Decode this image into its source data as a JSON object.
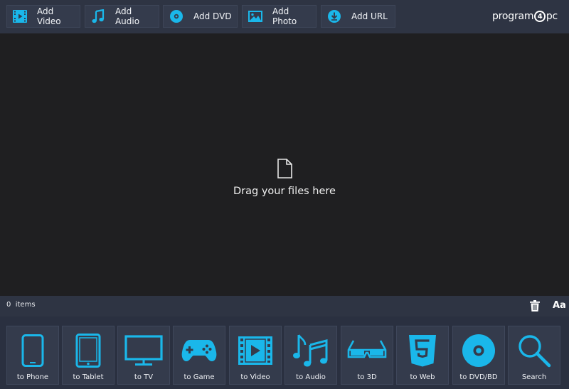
{
  "toolbar": {
    "buttons": [
      {
        "label": "Add Video",
        "icon": "film-icon"
      },
      {
        "label": "Add Audio",
        "icon": "music-note-icon"
      },
      {
        "label": "Add DVD",
        "icon": "disc-icon"
      },
      {
        "label": "Add Photo",
        "icon": "photo-icon"
      },
      {
        "label": "Add URL",
        "icon": "download-cloud-icon"
      }
    ],
    "logo": {
      "part1": "program",
      "part2": "4",
      "part3": "pc"
    }
  },
  "dropzone": {
    "icon": "file-icon",
    "text": "Drag your files here"
  },
  "status": {
    "count": "0",
    "count_unit": "items",
    "font_button": "Aa"
  },
  "presets": [
    {
      "label": "to Phone",
      "icon": "phone-icon"
    },
    {
      "label": "to Tablet",
      "icon": "tablet-icon"
    },
    {
      "label": "to TV",
      "icon": "tv-icon"
    },
    {
      "label": "to Game",
      "icon": "gamepad-icon"
    },
    {
      "label": "to Video",
      "icon": "video-film-icon"
    },
    {
      "label": "to Audio",
      "icon": "music-icon"
    },
    {
      "label": "to 3D",
      "icon": "3d-glasses-icon"
    },
    {
      "label": "to Web",
      "icon": "html5-icon"
    },
    {
      "label": "to DVD/BD",
      "icon": "disc-icon"
    },
    {
      "label": "Search",
      "icon": "search-icon"
    }
  ],
  "colors": {
    "accent": "#1ab7ea",
    "toolbar_bg": "#2e3443",
    "button_bg": "#343b4c",
    "canvas_bg": "#1f1f21"
  }
}
